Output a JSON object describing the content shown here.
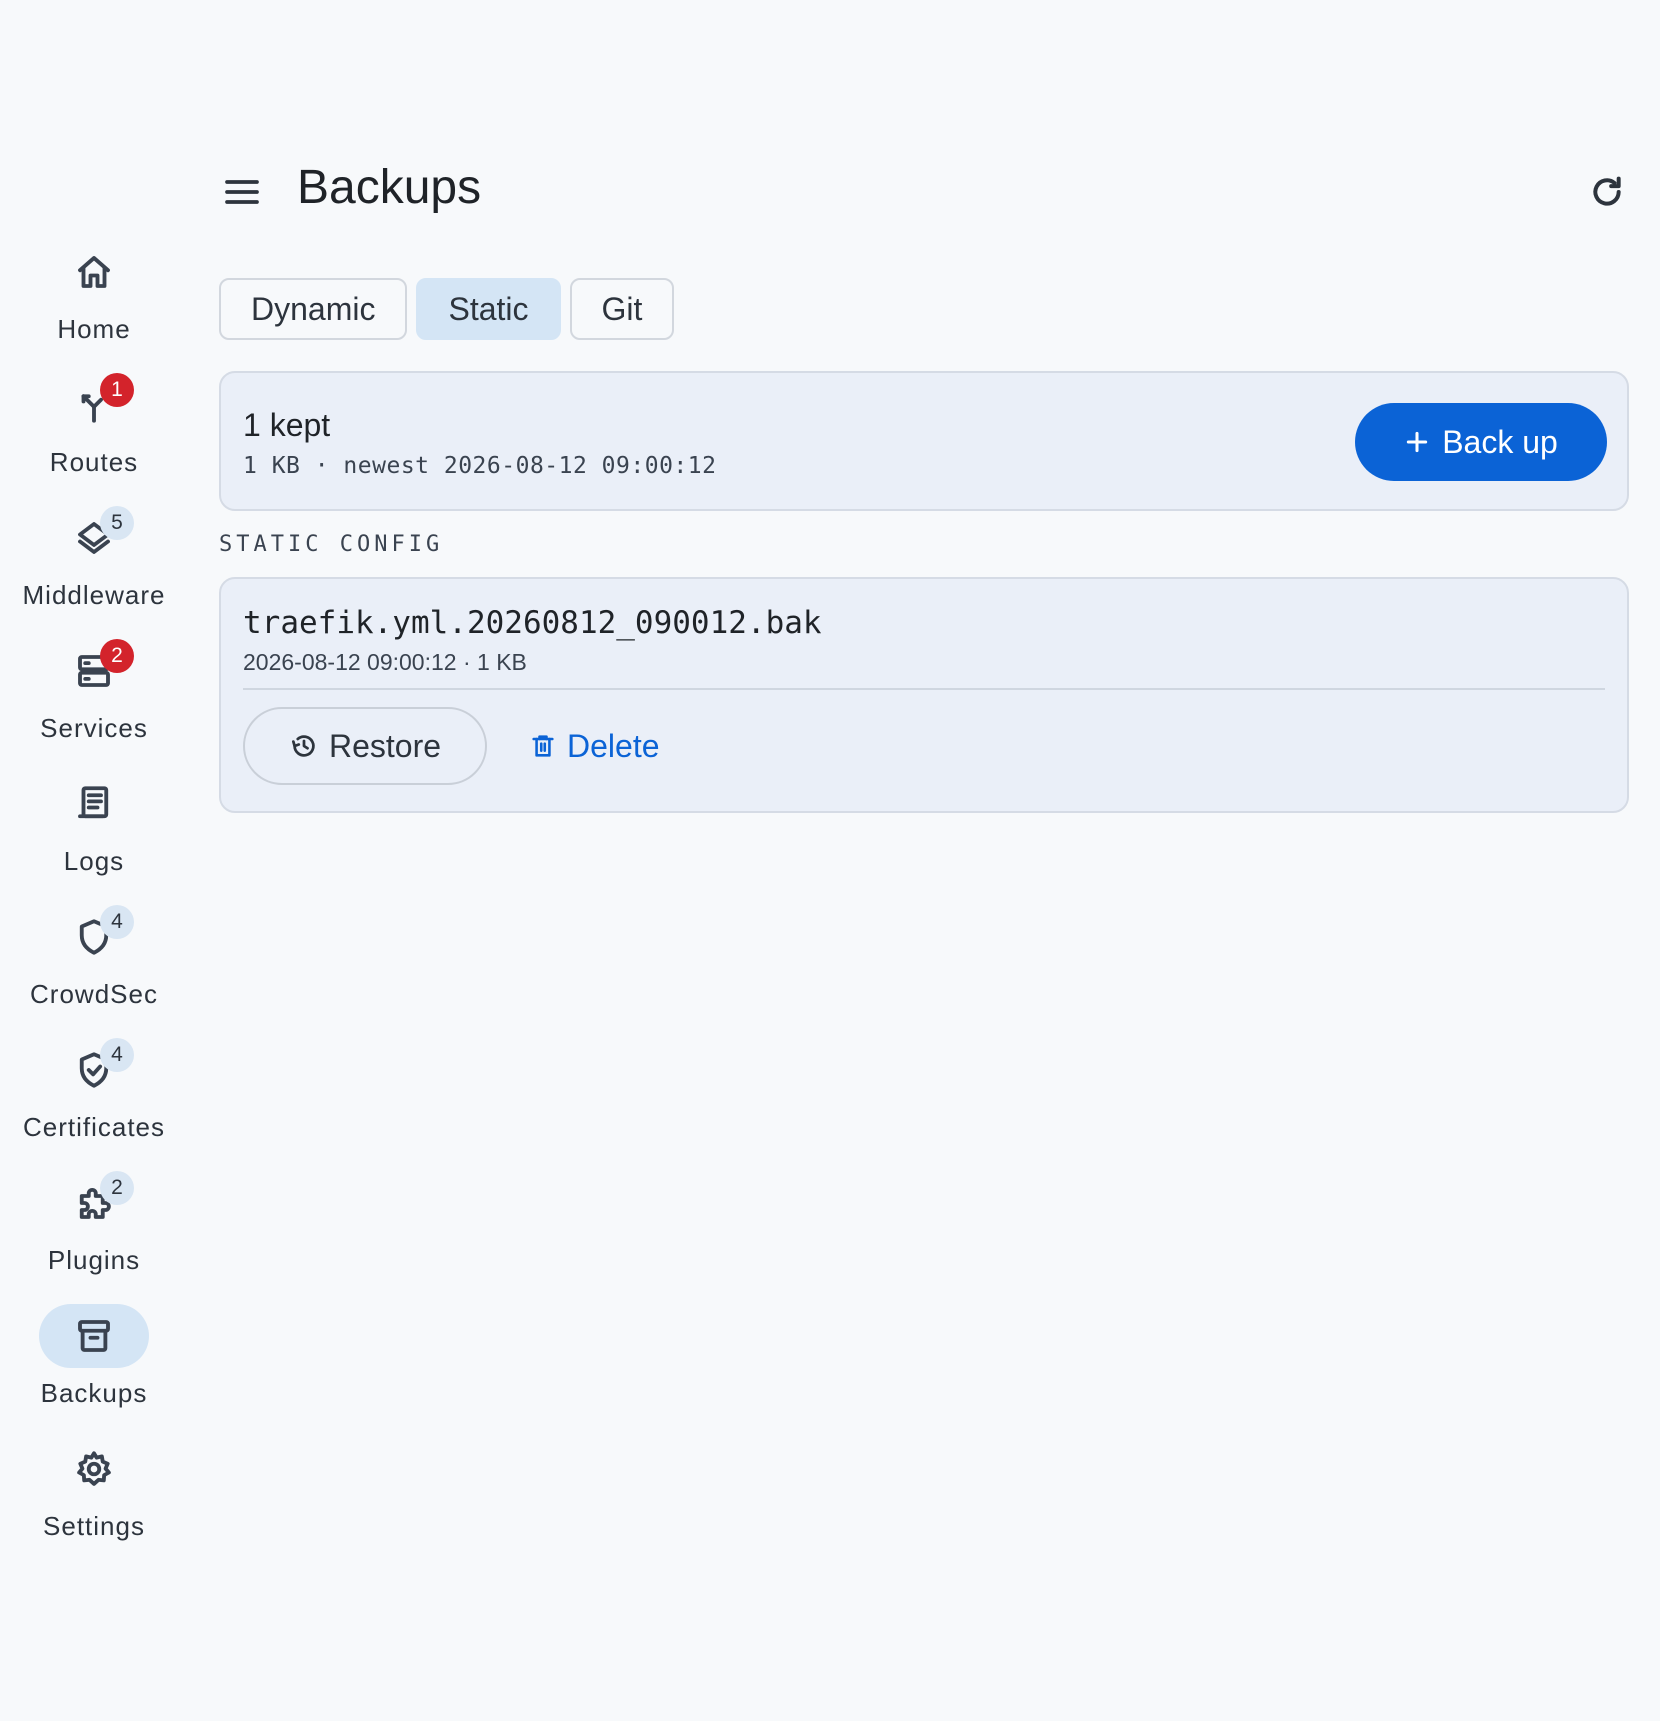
{
  "header": {
    "title": "Backups",
    "menu_icon": "menu-icon",
    "refresh_icon": "refresh-icon"
  },
  "nav": {
    "items": [
      {
        "label": "Home",
        "icon": "home-icon",
        "badge": "",
        "badge_style": ""
      },
      {
        "label": "Routes",
        "icon": "routes-icon",
        "badge": "1",
        "badge_style": "red"
      },
      {
        "label": "Middleware",
        "icon": "layers-icon",
        "badge": "5",
        "badge_style": "soft"
      },
      {
        "label": "Services",
        "icon": "server-icon",
        "badge": "2",
        "badge_style": "red"
      },
      {
        "label": "Logs",
        "icon": "logs-icon",
        "badge": "",
        "badge_style": ""
      },
      {
        "label": "CrowdSec",
        "icon": "shield-icon",
        "badge": "4",
        "badge_style": "soft"
      },
      {
        "label": "Certificates",
        "icon": "shield-check-icon",
        "badge": "4",
        "badge_style": "soft"
      },
      {
        "label": "Plugins",
        "icon": "puzzle-icon",
        "badge": "2",
        "badge_style": "soft"
      },
      {
        "label": "Backups",
        "icon": "archive-icon",
        "badge": "",
        "badge_style": ""
      },
      {
        "label": "Settings",
        "icon": "gear-icon",
        "badge": "",
        "badge_style": ""
      }
    ],
    "active": "Backups"
  },
  "tabs": {
    "items": [
      {
        "label": "Dynamic"
      },
      {
        "label": "Static"
      },
      {
        "label": "Git"
      }
    ],
    "selected": "Static"
  },
  "summary": {
    "count_text": "1 kept",
    "meta_text": "1 KB · newest 2026-08-12 09:00:12",
    "backup_button_label": "Back up",
    "backup_button_icon": "plus-icon"
  },
  "section": {
    "label": "STATIC CONFIG"
  },
  "files": [
    {
      "name": "traefik.yml.20260812_090012.bak",
      "meta": "2026-08-12 09:00:12 · 1 KB",
      "restore_label": "Restore",
      "restore_icon": "history-icon",
      "delete_label": "Delete",
      "delete_icon": "trash-icon"
    }
  ],
  "colors": {
    "accent": "#0b63d6",
    "selected_bg": "#d4e5f5",
    "badge_red": "#d3232b",
    "card_bg": "#eaeff8",
    "page_bg": "#f7f9fb"
  }
}
